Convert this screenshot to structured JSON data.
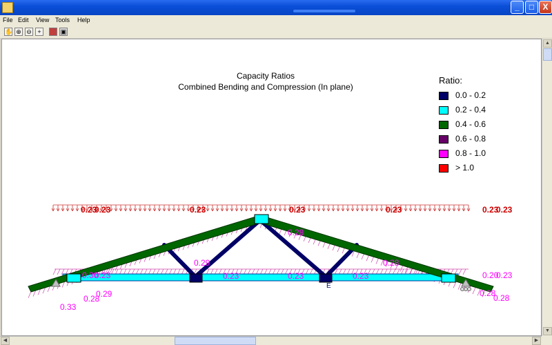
{
  "menu": [
    "File",
    "Edit",
    "View",
    "Tools",
    "Help"
  ],
  "window_buttons": [
    "_",
    "□",
    "X"
  ],
  "toolbar_icons": [
    "pan-hand-icon",
    "zoom-in-icon",
    "zoom-out-icon",
    "crosshair-icon",
    "color-chart-icon",
    "window-icon"
  ],
  "chart": {
    "title_line1": "Capacity Ratios",
    "title_line2": "Combined Bending and Compression (In plane)"
  },
  "legend": {
    "title": "Ratio:",
    "items": [
      {
        "label": "0.0 - 0.2",
        "color": "#000066"
      },
      {
        "label": "0.2 - 0.4",
        "color": "#00ffff"
      },
      {
        "label": "0.4 - 0.6",
        "color": "#006600"
      },
      {
        "label": "0.6 - 0.8",
        "color": "#660066"
      },
      {
        "label": "0.8 - 1.0",
        "color": "#ff00ff"
      },
      {
        "label": "> 1.0",
        "color": "#ff0000"
      }
    ]
  },
  "load_labels": {
    "top_left": "0.23",
    "top_left_b": "0.23",
    "top_1": "0.23",
    "top_2": "0.23",
    "top_3": "0.23",
    "top_right": "0.23",
    "top_right_b": "0.23"
  },
  "ratio_labels": {
    "left_chord": "0.29",
    "web_left": "0.28",
    "right_chord": "0.28",
    "bot_left_a": "0.30",
    "bot_left_b": "0.23",
    "bot_1": "0.23",
    "bot_2": "0.23",
    "bot_3": "0.23",
    "bot_right_a": "0.20",
    "bot_right_b": "0.23",
    "left_end_1": "0.33",
    "left_end_2": "0.28",
    "left_end_3": "0.29",
    "right_end_1": "0.28",
    "right_end_2": "0.28"
  },
  "node_label": "E",
  "colors": {
    "top_chord": "#006600",
    "web": "#000066",
    "bottom_chord": "#00ffff",
    "load": "#cc0000",
    "label": "#ff00ff"
  }
}
